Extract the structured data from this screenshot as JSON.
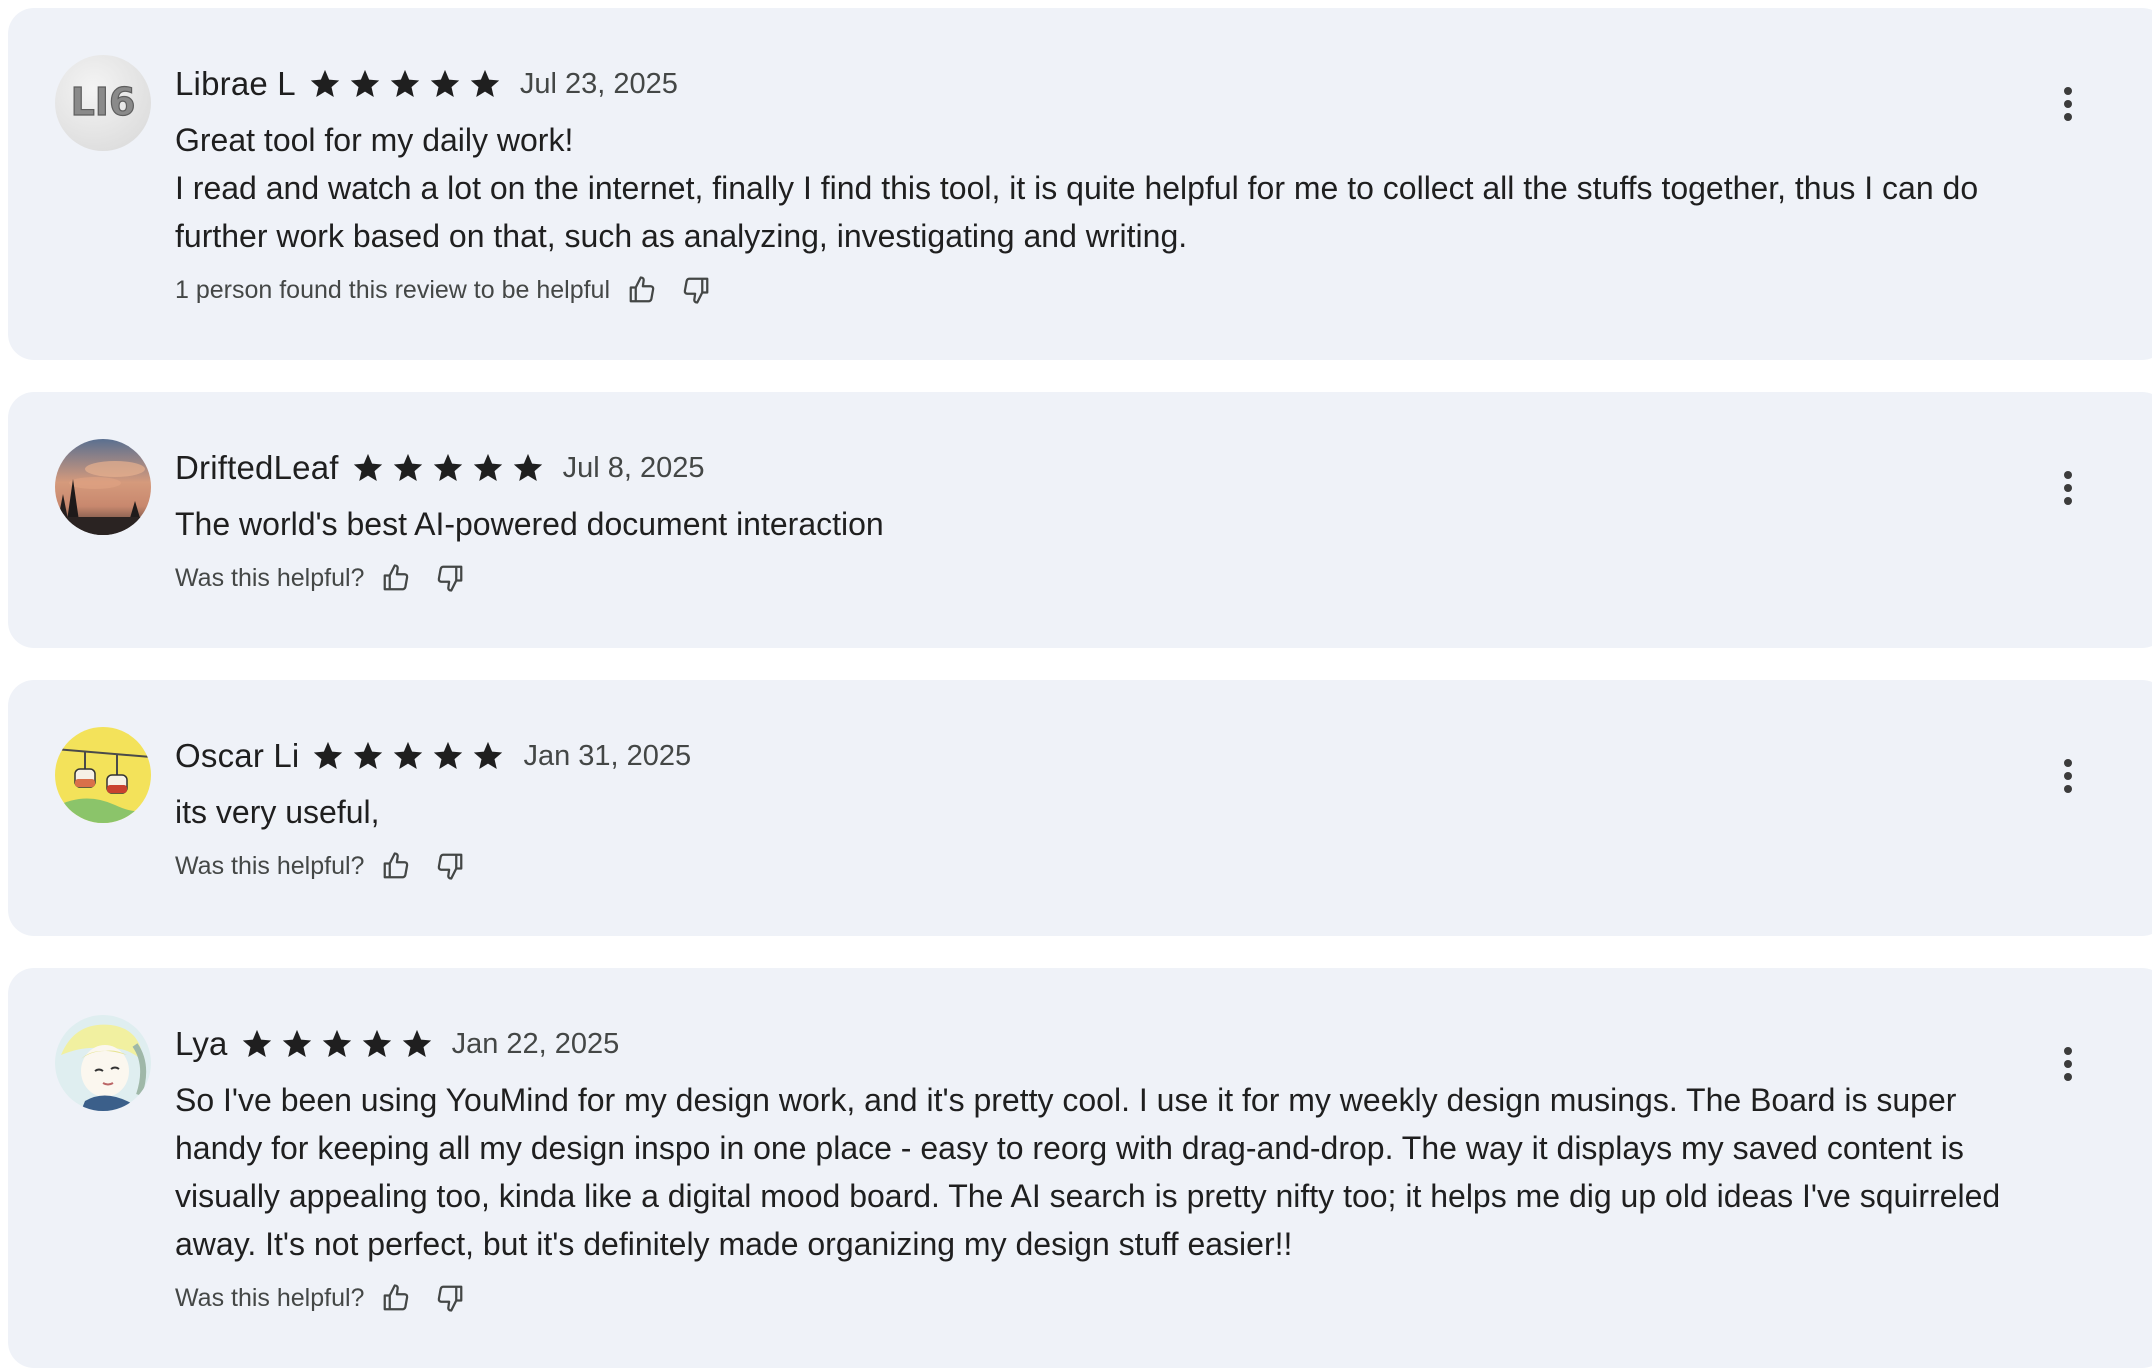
{
  "reviews": [
    {
      "author": "Librae L",
      "avatar_text": "LI6",
      "rating": 5,
      "date": "Jul 23, 2025",
      "title": "Great tool for my daily work!",
      "text": "I read and watch a lot on the internet, finally I find this tool, it is quite helpful for me to collect all the stuffs together, thus I can do further work based on that, such as analyzing, investigating and writing.",
      "helpful_text": "1 person found this review to be helpful"
    },
    {
      "author": "DriftedLeaf",
      "rating": 5,
      "date": "Jul 8, 2025",
      "title": "",
      "text": "The world's best AI-powered document interaction",
      "helpful_text": "Was this helpful?"
    },
    {
      "author": "Oscar Li",
      "rating": 5,
      "date": "Jan 31, 2025",
      "title": "",
      "text": "its very useful,",
      "helpful_text": "Was this helpful?"
    },
    {
      "author": "Lya",
      "rating": 5,
      "date": "Jan 22, 2025",
      "title": "",
      "text": "So I've been using YouMind for my design work, and it's pretty cool. I use it for my weekly design musings. The Board is super handy for keeping all my design inspo in one place - easy to reorg with drag-and-drop. The way it displays my saved content is visually appealing too, kinda like a digital mood board. The AI search is pretty nifty too; it helps me dig up old ideas I've squirreled away. It's not perfect, but it's definitely made organizing my design stuff easier!!",
      "helpful_text": "Was this helpful?"
    }
  ],
  "icons": {
    "star": "star-icon",
    "thumb_up": "thumb-up-icon",
    "thumb_down": "thumb-down-icon",
    "more": "more-vert-icon"
  },
  "colors": {
    "card_bg": "#eff2f8",
    "star": "#1f1f1f",
    "secondary_text": "#444746"
  }
}
